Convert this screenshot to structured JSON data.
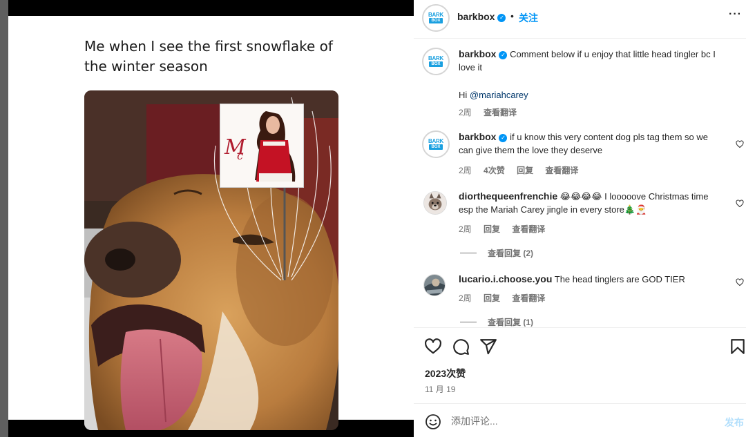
{
  "media": {
    "caption": "Me when I see the first snowflake of the winter season"
  },
  "header": {
    "username": "barkbox",
    "dot": "•",
    "follow_label": "关注",
    "more_label": "···"
  },
  "comments": [
    {
      "username": "barkbox",
      "text": "Comment below if u enjoy that little head tingler bc I love it",
      "extra_prefix": "Hi ",
      "extra_mention": "@mariahcarey",
      "time": "2周",
      "translate": "查看翻译"
    },
    {
      "username": "barkbox",
      "text": "if u know this very content dog pls tag them so we can give them the love they deserve",
      "time": "2周",
      "likes": "4次赞",
      "reply": "回复",
      "translate": "查看翻译"
    },
    {
      "username": "diorthequeenfrenchie",
      "text": "😂😂😂😂 I looooove Christmas time esp the Mariah Carey jingle in every store🎄🎅",
      "time": "2周",
      "reply": "回复",
      "translate": "查看翻译",
      "view_replies": "查看回复 (2)"
    },
    {
      "username": "lucario.i.choose.you",
      "text": "The head tinglers are GOD TIER",
      "time": "2周",
      "reply": "回复",
      "translate": "查看翻译",
      "view_replies": "查看回复 (1)"
    }
  ],
  "actions": {
    "likes": "2023次赞",
    "date": "11 月 19"
  },
  "composer": {
    "placeholder": "添加评论...",
    "post_label": "发布"
  },
  "colors": {
    "accent": "#0095f6",
    "text": "#262626",
    "muted": "#737373",
    "divider": "#efefef",
    "post_disabled": "#b2dffc"
  }
}
